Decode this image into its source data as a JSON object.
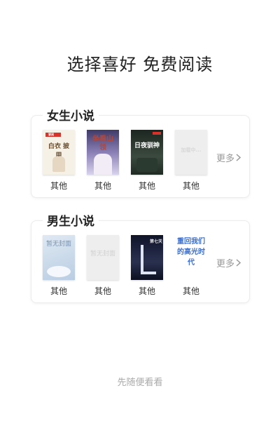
{
  "page": {
    "title": "选择喜好 免费阅读",
    "skip_label": "先随便看看"
  },
  "sections": [
    {
      "title": "女生小说",
      "more_label": "更多",
      "books": [
        {
          "genre": "其他",
          "cover_text": "白衣 披甲",
          "publisher_tag": "掌阅"
        },
        {
          "genre": "其他",
          "cover_text": "坐看山领"
        },
        {
          "genre": "其他",
          "cover_text": "日夜驯神"
        },
        {
          "genre": "其他",
          "cover_text": "加载中..."
        }
      ]
    },
    {
      "title": "男生小说",
      "more_label": "更多",
      "books": [
        {
          "genre": "其他",
          "cover_text": "暂无封面"
        },
        {
          "genre": "其他",
          "cover_text": "暂无封面"
        },
        {
          "genre": "其他",
          "cover_text": "第七天"
        },
        {
          "genre": "其他",
          "cover_text": "重回我们的高光时代"
        }
      ]
    }
  ],
  "colors": {
    "title": "#222222",
    "muted": "#999999",
    "skip": "#aaaaaa",
    "accent_red": "#d9322a"
  }
}
